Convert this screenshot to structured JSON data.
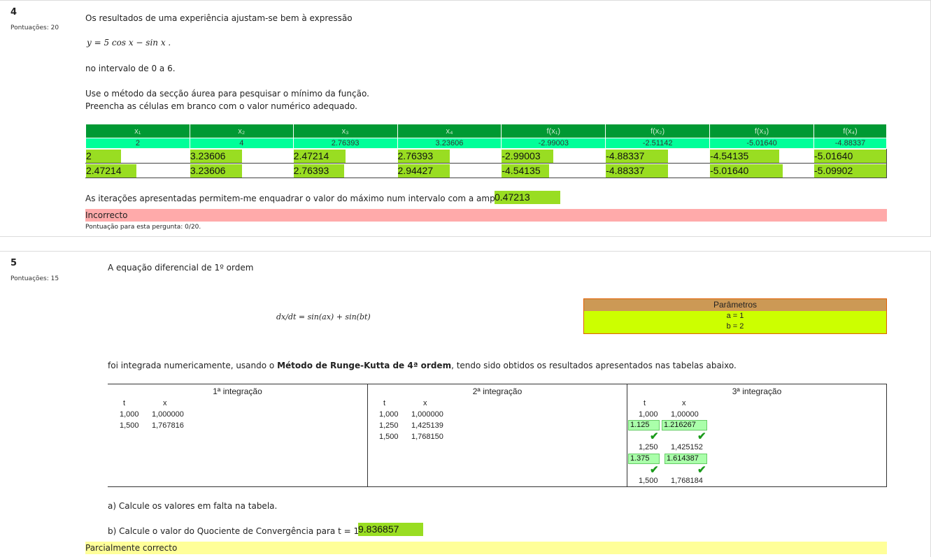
{
  "q4": {
    "number": "4",
    "score_label": "Pontuações: 20",
    "intro": "Os resultados de uma experiência ajustam-se bem à expressão",
    "formula": "y = 5 cos x − sin x .",
    "interval": "no intervalo de 0 a 6.",
    "instruction1": "Use o método da secção áurea para pesquisar o mínimo da função.",
    "instruction2": "Preencha as células em branco com o valor numérico adequado.",
    "table": {
      "headers": [
        "x₁",
        "x₂",
        "x₃",
        "x₄",
        "f(x₁)",
        "f(x₂)",
        "f(x₃)",
        "f(x₄)"
      ],
      "given": [
        "2",
        "4",
        "2.76393",
        "3.23606",
        "-2.99003",
        "-2.51142",
        "-5.01640",
        "-4.88337"
      ],
      "rows": [
        [
          "2",
          "3.23606",
          "2.47214",
          "2.76393",
          "-2.99003",
          "-4.88337",
          "-4.54135",
          "-5.01640"
        ],
        [
          "2.47214",
          "3.23606",
          "2.76393",
          "2.94427",
          "-4.54135",
          "-4.88337",
          "-5.01640",
          "-5.09902"
        ]
      ]
    },
    "amplitude_text": "As iterações apresentadas permitem-me enquadrar o valor do máximo num intervalo com a amplitude",
    "amplitude_value": "0.47213",
    "feedback": "Incorrecto",
    "score_result": "Pontuação para esta pergunta: 0/20."
  },
  "q5": {
    "number": "5",
    "score_label": "Pontuações: 15",
    "intro": "A equação diferencial de 1º ordem",
    "equation": "dx/dt = sin(ax) + sin(bt)",
    "params": {
      "title": "Parâmetros",
      "a": "a = 1",
      "b": "b = 2"
    },
    "integrated_pre": "foi integrada numericamente, usando o ",
    "integrated_bold": "Método de Runge-Kutta de 4ª ordem",
    "integrated_post": ", tendo sido obtidos os resultados apresentados nas tabelas abaixo.",
    "rk": {
      "col1": {
        "title": "1ª integração",
        "t_header": "t",
        "x_header": "x",
        "rows": [
          [
            "1,000",
            "1,000000"
          ],
          [
            "1,500",
            "1,767816"
          ]
        ]
      },
      "col2": {
        "title": "2ª integração",
        "t_header": "t",
        "x_header": "x",
        "rows": [
          [
            "1,000",
            "1,000000"
          ],
          [
            "1,250",
            "1,425139"
          ],
          [
            "1,500",
            "1,768150"
          ]
        ]
      },
      "col3": {
        "title": "3ª integração",
        "t_header": "t",
        "x_header": "x",
        "row1": [
          "1,000",
          "1,00000"
        ],
        "ans1": [
          "1.125",
          "1.216267"
        ],
        "row2": [
          "1,250",
          "1,425152"
        ],
        "ans2": [
          "1.375",
          "1.614387"
        ],
        "row3": [
          "1,500",
          "1,768184"
        ]
      }
    },
    "part_a": "a) Calcule os valores em falta na tabela.",
    "part_b": "b) Calcule o valor do Quociente de Convergência para t = 1.5",
    "part_b_value": "9.836857",
    "feedback": "Parcialmente correcto"
  }
}
